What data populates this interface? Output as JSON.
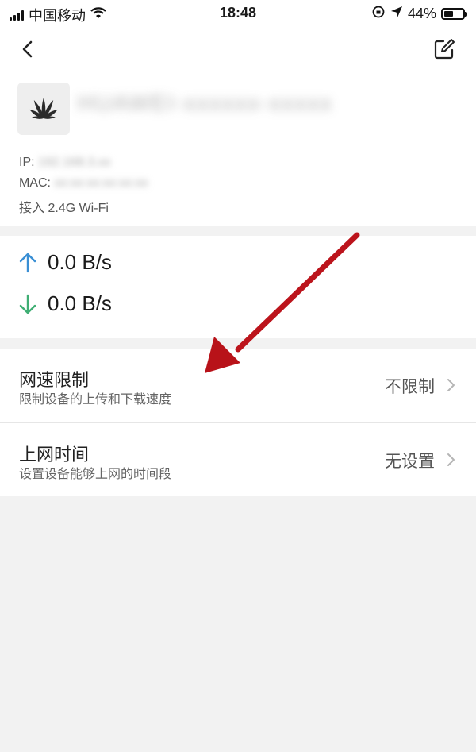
{
  "status_bar": {
    "carrier": "中国移动",
    "time": "18:48",
    "battery": "44%",
    "battery_level": 0.44
  },
  "header": {
    "back_icon": "chevron-left-icon",
    "edit_icon": "edit-icon"
  },
  "device": {
    "logo_icon": "huawei-logo-icon",
    "name": "HUAWEI-xxxxxx-xxxxx",
    "ip_label": "IP:",
    "ip_value": "192.168.3.xx",
    "mac_label": "MAC:",
    "mac_value": "xx:xx:xx:xx:xx:xx",
    "band": "接入 2.4G Wi-Fi"
  },
  "speed": {
    "upload": "0.0 B/s",
    "download": "0.0 B/s",
    "upload_color": "#3a8fd4",
    "download_color": "#3fae74"
  },
  "settings": [
    {
      "title": "网速限制",
      "subtitle": "限制设备的上传和下载速度",
      "value": "不限制"
    },
    {
      "title": "上网时间",
      "subtitle": "设置设备能够上网的时间段",
      "value": "无设置"
    }
  ],
  "annotation": {
    "color": "#c8161d"
  }
}
